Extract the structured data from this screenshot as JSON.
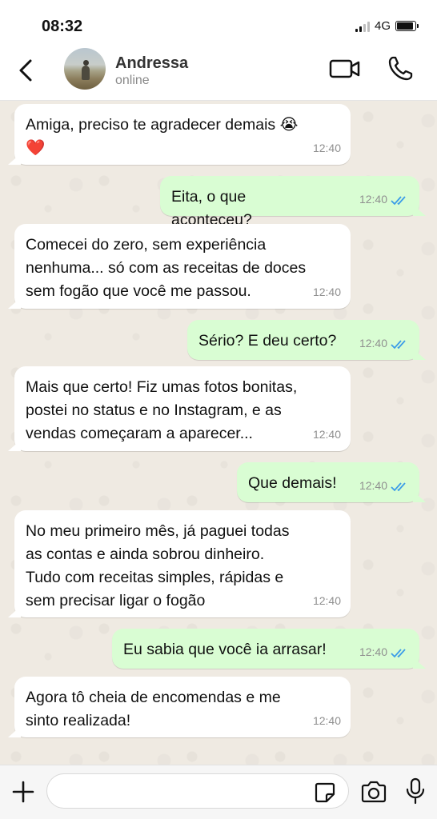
{
  "status_bar": {
    "time": "08:32",
    "network": "4G",
    "battery_level": 0.9
  },
  "header": {
    "contact_name": "Andressa",
    "contact_status": "online"
  },
  "messages": [
    {
      "direction": "in",
      "text": "Amiga, preciso te agradecer demais 😭\n❤️",
      "time": "12:40"
    },
    {
      "direction": "out",
      "text": "Eita, o que aconteceu?",
      "time": "12:40",
      "status": "read"
    },
    {
      "direction": "in",
      "text": "Comecei do zero, sem experiência\nnenhuma... só com as receitas de doces\nsem fogão que você me passou.",
      "time": "12:40"
    },
    {
      "direction": "out",
      "text": "Sério? E deu certo?",
      "time": "12:40",
      "status": "read"
    },
    {
      "direction": "in",
      "text": "Mais que certo! Fiz umas fotos bonitas,\npostei no status e no Instagram, e as\nvendas começaram a aparecer...",
      "time": "12:40"
    },
    {
      "direction": "out",
      "text": "Que demais!",
      "time": "12:40",
      "status": "read"
    },
    {
      "direction": "in",
      "text": "No meu primeiro mês, já paguei todas\nas contas e ainda sobrou dinheiro.\nTudo com receitas simples, rápidas e\nsem precisar ligar o fogão",
      "time": "12:40"
    },
    {
      "direction": "out",
      "text": "Eu sabia que você ia arrasar!",
      "time": "12:40",
      "status": "read"
    },
    {
      "direction": "in",
      "text": "Agora tô cheia de encomendas e me\nsinto realizada!",
      "time": "12:40"
    }
  ],
  "input": {
    "value": "",
    "placeholder": ""
  },
  "colors": {
    "incoming_bubble": "#ffffff",
    "outgoing_bubble": "#d9fdd3",
    "read_ticks": "#3b9ce8",
    "background": "#efeae2"
  },
  "icons": [
    "back-icon",
    "video-call-icon",
    "phone-icon",
    "plus-icon",
    "sticker-icon",
    "camera-icon",
    "mic-icon",
    "read-ticks-icon"
  ]
}
